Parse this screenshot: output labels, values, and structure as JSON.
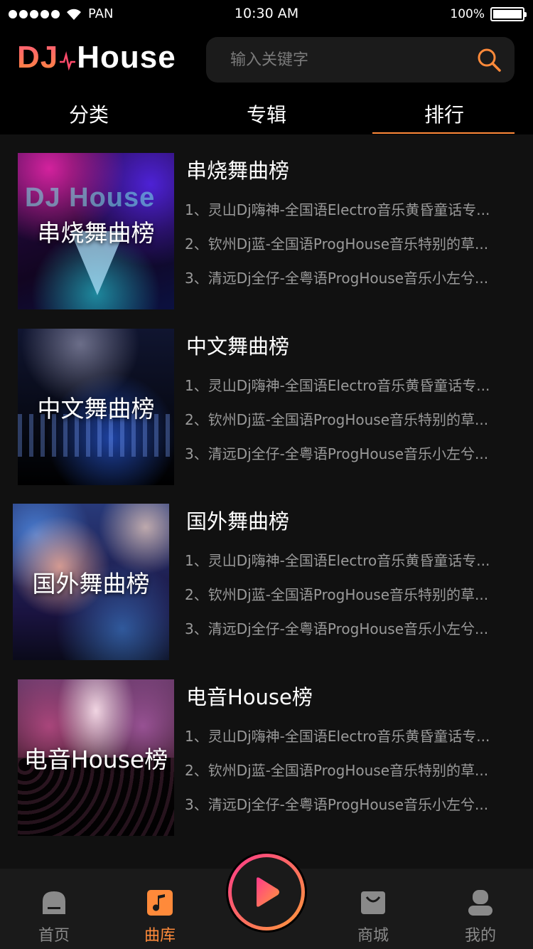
{
  "status_bar": {
    "carrier": "PAN",
    "time": "10:30 AM",
    "battery": "100%",
    "battery_level": 1.0
  },
  "header": {
    "logo_left": "DJ",
    "logo_right": "House",
    "search_placeholder": "输入关键字"
  },
  "tabs": [
    {
      "label": "分类",
      "active": false
    },
    {
      "label": "专辑",
      "active": false
    },
    {
      "label": "排行",
      "active": true
    }
  ],
  "charts": [
    {
      "title": "串烧舞曲榜",
      "cover_label": "串烧舞曲榜",
      "cover_text": "DJ House",
      "tracks": [
        "1、灵山Dj嗨神-全国语Electro音乐黄昏童话专...",
        "2、钦州Dj蓝-全国语ProgHouse音乐特别的草...",
        "3、清远Dj全仔-全粤语ProgHouse音乐小左兮..."
      ]
    },
    {
      "title": "中文舞曲榜",
      "cover_label": "中文舞曲榜",
      "tracks": [
        "1、灵山Dj嗨神-全国语Electro音乐黄昏童话专...",
        "2、钦州Dj蓝-全国语ProgHouse音乐特别的草...",
        "3、清远Dj全仔-全粤语ProgHouse音乐小左兮..."
      ]
    },
    {
      "title": "国外舞曲榜",
      "cover_label": "国外舞曲榜",
      "tracks": [
        "1、灵山Dj嗨神-全国语Electro音乐黄昏童话专...",
        "2、钦州Dj蓝-全国语ProgHouse音乐特别的草...",
        "3、清远Dj全仔-全粤语ProgHouse音乐小左兮..."
      ]
    },
    {
      "title": "电音House榜",
      "cover_label": "电音House榜",
      "tracks": [
        "1、灵山Dj嗨神-全国语Electro音乐黄昏童话专...",
        "2、钦州Dj蓝-全国语ProgHouse音乐特别的草...",
        "3、清远Dj全仔-全粤语ProgHouse音乐小左兮..."
      ]
    }
  ],
  "bottom_nav": [
    {
      "label": "首页",
      "icon": "home-icon",
      "active": false
    },
    {
      "label": "曲库",
      "icon": "music-library-icon",
      "active": true
    },
    {
      "label": "商城",
      "icon": "shopping-bag-icon",
      "active": false
    },
    {
      "label": "我的",
      "icon": "user-icon",
      "active": false
    }
  ],
  "colors": {
    "accent": "#ff8a3a",
    "accent_pink": "#ff3a8a",
    "background": "#111111",
    "muted_text": "#9a9a9a"
  }
}
